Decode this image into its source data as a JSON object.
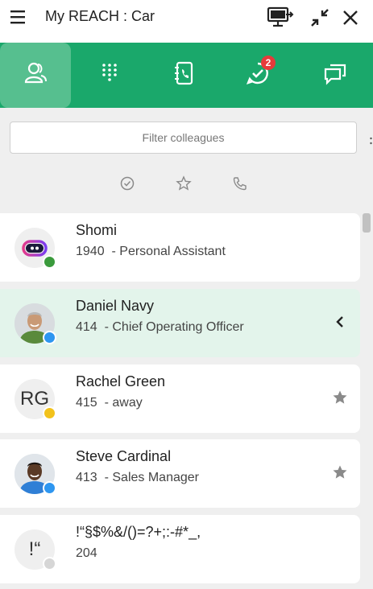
{
  "titlebar": {
    "title": "My REACH : Car",
    "icons": [
      "menu-icon",
      "screen-share-icon",
      "minimize-icon",
      "close-icon"
    ]
  },
  "tabs": [
    {
      "name": "contacts",
      "icon": "contacts-icon",
      "active": true
    },
    {
      "name": "dialpad",
      "icon": "dialpad-icon",
      "active": false
    },
    {
      "name": "phonebook",
      "icon": "phonebook-icon",
      "active": false
    },
    {
      "name": "tasks",
      "icon": "check-bubble-icon",
      "active": false,
      "badge": "2"
    },
    {
      "name": "chat",
      "icon": "chat-icon",
      "active": false
    }
  ],
  "filter": {
    "placeholder": "Filter colleagues"
  },
  "filter_icons": [
    "check-circle-icon",
    "star-outline-icon",
    "phone-outline-icon"
  ],
  "colors": {
    "brand": "#1aa86b",
    "badge": "#e53b3b",
    "online": "#3a9a3c",
    "busy": "#2e96f0",
    "away": "#f2c21b",
    "offline": "#d6d6d6",
    "selected": "#e3f4eb"
  },
  "contacts": [
    {
      "name": "Shomi",
      "ext": "1940",
      "detail": "Personal Assistant",
      "status": "online",
      "avatar": "bot-logo"
    },
    {
      "name": "Daniel Navy",
      "ext": "414",
      "detail": "Chief Operating Officer",
      "status": "busy",
      "avatar": "photo",
      "selected": true,
      "action": "chevron-left-icon"
    },
    {
      "name": "Rachel Green",
      "ext": "415",
      "detail": "away",
      "status": "away",
      "avatar": "initials",
      "initials": "RG",
      "action": "star-icon"
    },
    {
      "name": "Steve Cardinal",
      "ext": "413",
      "detail": "Sales Manager",
      "status": "busy",
      "avatar": "photo",
      "action": "star-icon"
    },
    {
      "name": "!“§$%&/()=?+;:-#*_,",
      "ext": "204",
      "detail": "",
      "status": "offline",
      "avatar": "initials",
      "initials": "!“"
    }
  ]
}
